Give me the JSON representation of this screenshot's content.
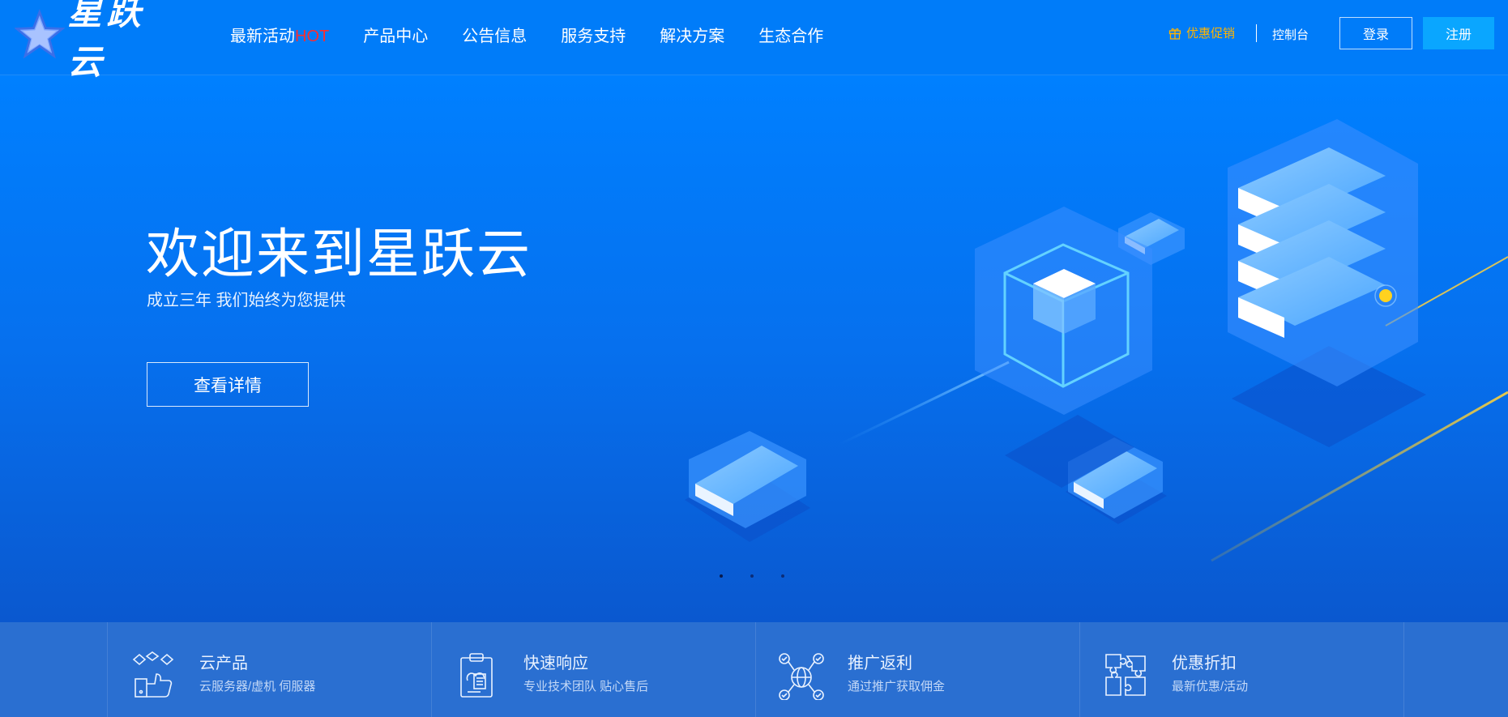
{
  "brand": {
    "name": "星跃云",
    "logo_icon": "star-icon"
  },
  "nav": {
    "items": [
      {
        "label": "最新活动",
        "badge": "HOT"
      },
      {
        "label": "产品中心"
      },
      {
        "label": "公告信息"
      },
      {
        "label": "服务支持"
      },
      {
        "label": "解决方案"
      },
      {
        "label": "生态合作"
      }
    ]
  },
  "header_right": {
    "promo": "优惠促销",
    "promo_icon": "gift-icon",
    "console": "控制台",
    "login": "登录",
    "register": "注册"
  },
  "hero": {
    "title": "欢迎来到星跃云",
    "subtitle": "成立三年 我们始终为您提供",
    "button": "查看详情",
    "slide_count": 3,
    "active_slide": 1
  },
  "features": [
    {
      "icon": "cloud-like-icon",
      "title": "云产品",
      "desc": "云服务器/虚机 伺服器"
    },
    {
      "icon": "clipboard-icon",
      "title": "快速响应",
      "desc": "专业技术团队 贴心售后"
    },
    {
      "icon": "network-globe-icon",
      "title": "推广返利",
      "desc": "通过推广获取佣金"
    },
    {
      "icon": "puzzle-icon",
      "title": "优惠折扣",
      "desc": "最新优惠/活动"
    }
  ],
  "colors": {
    "header_bg": "#007cf9",
    "promo": "#ffb400",
    "hot": "#ff2d2d",
    "register_bg": "#0aa6ff",
    "features_bg": "#2a6fd1"
  }
}
